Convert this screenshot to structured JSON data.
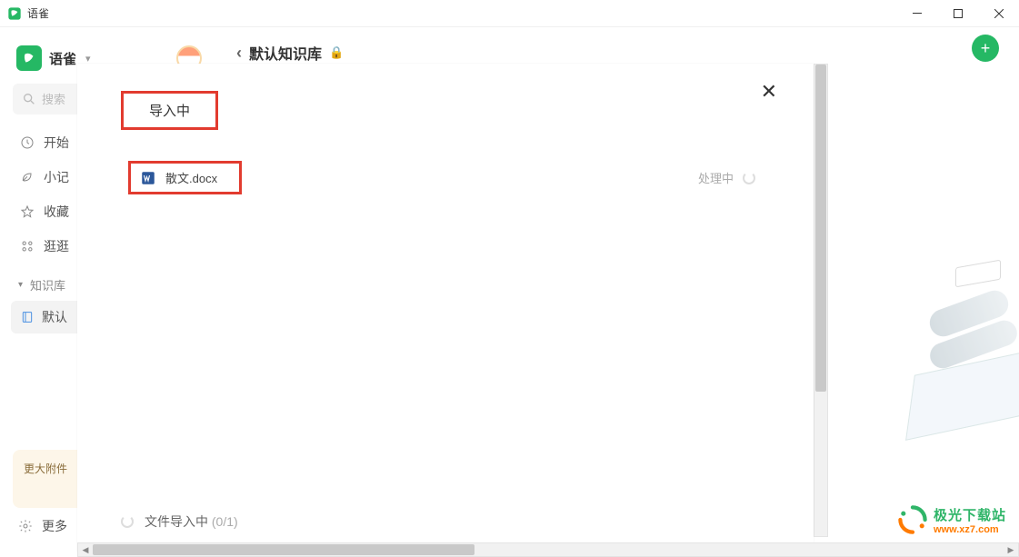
{
  "titlebar": {
    "title": "语雀"
  },
  "workspace": {
    "name": "语雀"
  },
  "search": {
    "placeholder": "搜索"
  },
  "nav": {
    "start": "开始",
    "notes": "小记",
    "fav": "收藏",
    "explore": "逛逛"
  },
  "section_kb": "知识库",
  "kb_item": "默认",
  "upgrade": {
    "text": "更大附件"
  },
  "more": "更多",
  "main": {
    "kb_title": "默认知识库"
  },
  "modal": {
    "title": "导入中",
    "file_name": "散文.docx",
    "file_status": "处理中",
    "footer_text": "文件导入中",
    "footer_count": "(0/1)"
  },
  "watermark": {
    "title": "极光下载站",
    "url": "www.xz7.com"
  }
}
